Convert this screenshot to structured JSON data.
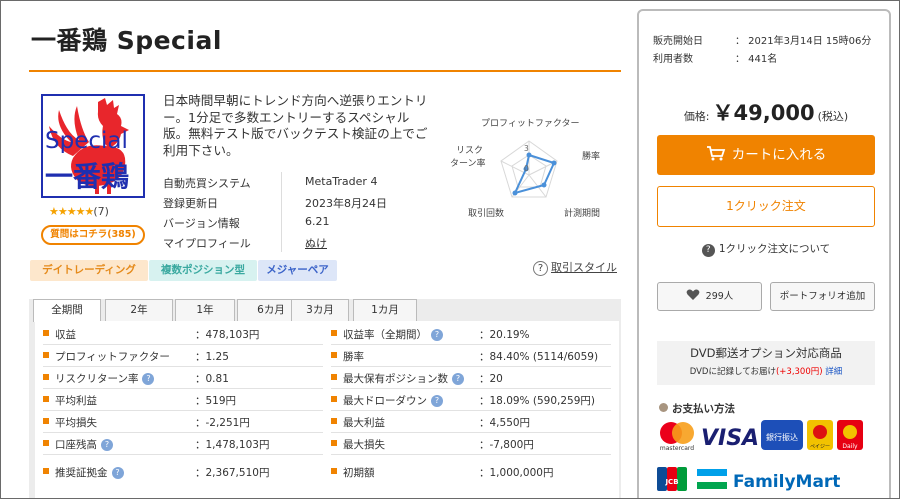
{
  "product": {
    "title": "一番鶏 Special",
    "description": "日本時間早朝にトレンド方向へ逆張りエントリー。1分足で多数エントリーするスペシャル版。無料テスト版でバックテスト検証の上でご利用下さい。",
    "logo": {
      "line1": "Special",
      "line2": "一番鶏",
      "colors": {
        "bird": "#e8262c",
        "text": "#1f2fb0"
      }
    },
    "rating": {
      "stars": "★★★★★",
      "count": "(7)"
    },
    "review_button": "質問はコチラ(385)"
  },
  "info": [
    {
      "label": "自動売買システム",
      "value": "MetaTrader 4"
    },
    {
      "label": "登録更新日",
      "value": "2023年8月24日"
    },
    {
      "label": "バージョン情報",
      "value": "6.21"
    },
    {
      "label": "マイプロフィール",
      "value": "ぬけ"
    }
  ],
  "radar": {
    "labels": {
      "profit_factor": "プロフィットファクター",
      "win_rate": "勝率",
      "period": "計測期間",
      "trades": "取引回数",
      "risk_return": "リスク\nターン率"
    },
    "scale_labels": [
      "3",
      "0"
    ],
    "line_color": "#4a90d9"
  },
  "tags": [
    {
      "label": "デイトレーディング",
      "bg": "#fde7cc",
      "fg": "#e58a1a"
    },
    {
      "label": "複数ポジション型",
      "bg": "#d7f2f0",
      "fg": "#3aa9a0"
    },
    {
      "label": "メジャーペア",
      "bg": "#dde6f8",
      "fg": "#3a62c8"
    }
  ],
  "help_link": {
    "icon": "?",
    "label": "取引スタイル"
  },
  "tabs": [
    "全期間",
    "2年",
    "1年",
    "6カ月",
    "3カ月",
    "1カ月"
  ],
  "stats_left": [
    {
      "label": "収益",
      "value": "：478,103円",
      "help": false
    },
    {
      "label": "プロフィットファクター",
      "value": "：1.25",
      "help": false
    },
    {
      "label": "リスクリターン率",
      "value": "：0.81",
      "help": true
    },
    {
      "label": "平均利益",
      "value": "：519円",
      "help": false
    },
    {
      "label": "平均損失",
      "value": "：-2,251円",
      "help": false
    },
    {
      "label": "口座残高",
      "value": "：1,478,103円",
      "help": true
    },
    {
      "label": "推奨証拠金",
      "value": "：2,367,510円",
      "help": true
    }
  ],
  "stats_right": [
    {
      "label": "収益率（全期間）",
      "value": "：20.19%",
      "help": true
    },
    {
      "label": "勝率",
      "value": "：84.40% (5114/6059)",
      "help": false
    },
    {
      "label": "最大保有ポジション数",
      "value": "：20",
      "help": true
    },
    {
      "label": "最大ドローダウン",
      "value": "：18.09% (590,259円)",
      "help": true
    },
    {
      "label": "最大利益",
      "value": "：4,550円",
      "help": false
    },
    {
      "label": "最大損失",
      "value": "：-7,800円",
      "help": false
    },
    {
      "label": "初期額",
      "value": "：1,000,000円",
      "help": false
    }
  ],
  "sidebar": {
    "sale_start_label": "販売開始日",
    "sale_start_value": "： 2021年3月14日 15時06分",
    "users_label": "利用者数",
    "users_value": "： 441名",
    "price_label": "価格:",
    "price_value": "￥49,000",
    "price_tax": "(税込)",
    "cart_button": "カートに入れる",
    "oneclick_button": "1クリック注文",
    "oneclick_help": "1クリック注文について",
    "fav_count": "299人",
    "portfolio_button": "ポートフォリオ追加",
    "dvd_title": "DVD郵送オプション対応商品",
    "dvd_sub_a": "DVDに記録してお届け",
    "dvd_sub_price": "(+3,300円)",
    "dvd_sub_link": "詳細",
    "pay_title": "お支払い方法",
    "payment_logos": {
      "mastercard": "mastercard",
      "visa": "VISA",
      "bank": "銀行振込",
      "pay_easy": "ペイジー",
      "daily": "Daily",
      "jcb": "JCB",
      "familymart": "FamilyMart"
    },
    "colors": {
      "accent": "#f08300"
    }
  }
}
